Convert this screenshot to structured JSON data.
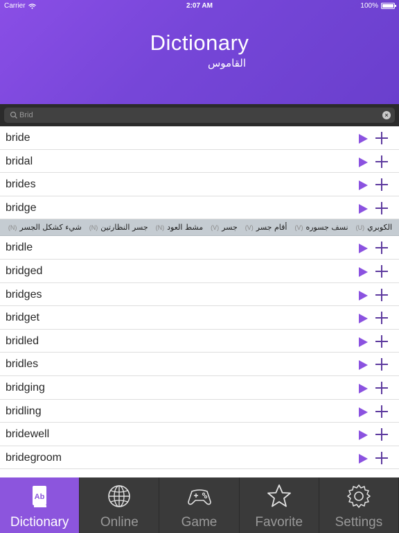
{
  "status": {
    "carrier": "Carrier",
    "time": "2:07 AM",
    "battery": "100%"
  },
  "header": {
    "title": "Dictionary",
    "subtitle": "القاموس"
  },
  "search": {
    "value": "Brid"
  },
  "words_top": [
    "bride",
    "bridal",
    "brides",
    "bridge"
  ],
  "translations": [
    {
      "text": "الكوبري",
      "tag": "(U)"
    },
    {
      "text": "نسف جسوره",
      "tag": "(V)"
    },
    {
      "text": "أقام جسر",
      "tag": "(V)"
    },
    {
      "text": "جسر",
      "tag": "(V)"
    },
    {
      "text": "مشط العود",
      "tag": "(N)"
    },
    {
      "text": "جسر النظارتين",
      "tag": "(N)"
    },
    {
      "text": "شيء كشكل الجسر",
      "tag": "(N)"
    }
  ],
  "words_bottom": [
    "bridle",
    "bridged",
    "bridges",
    "bridget",
    "bridled",
    "bridles",
    "bridging",
    "bridling",
    "bridewell",
    "bridegroom"
  ],
  "tabs": [
    {
      "label": "Dictionary",
      "icon": "dictionary-book-icon",
      "active": true
    },
    {
      "label": "Online",
      "icon": "globe-icon",
      "active": false
    },
    {
      "label": "Game",
      "icon": "gamepad-icon",
      "active": false
    },
    {
      "label": "Favorite",
      "icon": "star-icon",
      "active": false
    },
    {
      "label": "Settings",
      "icon": "gear-icon",
      "active": false
    }
  ],
  "colors": {
    "accent": "#8c55dd",
    "header": "#7646d8",
    "tabbar": "#3a3a3a"
  }
}
